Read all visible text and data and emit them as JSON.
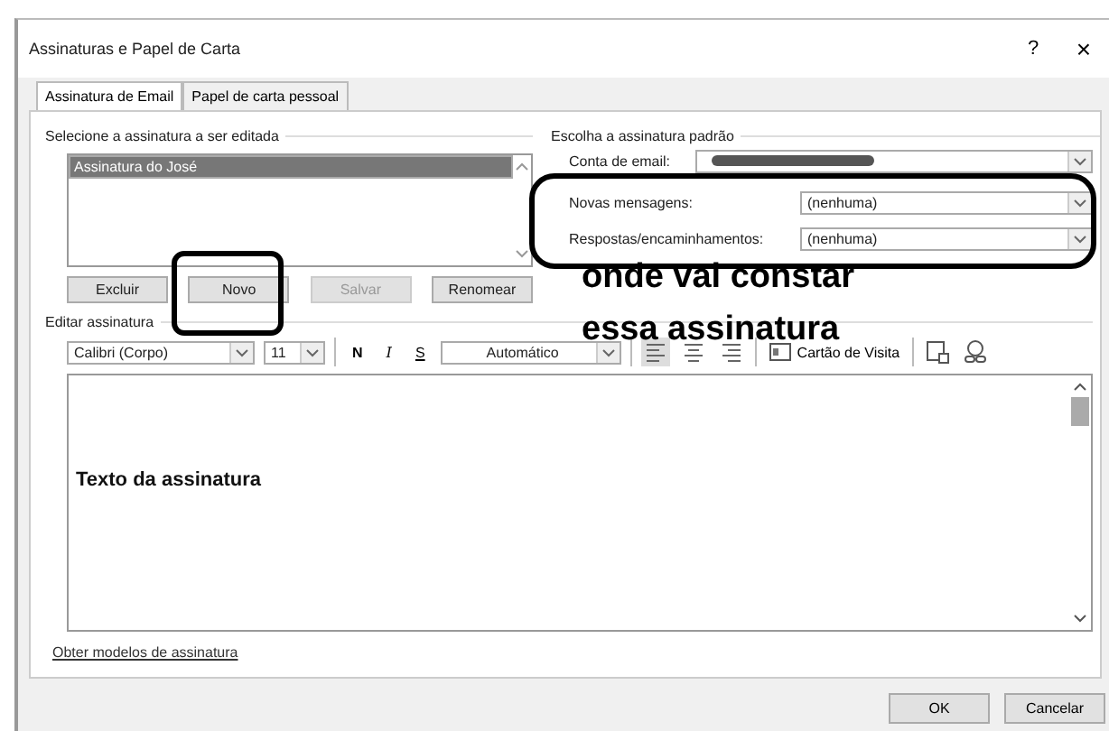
{
  "window": {
    "title": "Assinaturas e Papel de Carta",
    "help": "?",
    "close": "×"
  },
  "tabs": [
    {
      "label": "Assinatura de Email",
      "selected": true
    },
    {
      "label": "Papel de carta pessoal",
      "selected": false
    }
  ],
  "signatures": {
    "heading": "Selecione a assinatura a ser editada",
    "items": [
      {
        "label": "Assinatura do José",
        "selected": true
      }
    ],
    "buttons": [
      {
        "label": "Excluir",
        "disabled": false
      },
      {
        "label": "Novo",
        "disabled": false
      },
      {
        "label": "Salvar",
        "disabled": true
      },
      {
        "label": "Renomear",
        "disabled": false
      }
    ]
  },
  "defaults": {
    "heading": "Escolha a assinatura padrão",
    "fields": [
      {
        "kind": "account",
        "label": "Conta de email:"
      },
      {
        "kind": "select",
        "label": "Novas mensagens:",
        "value": "(nenhuma)"
      },
      {
        "kind": "select",
        "label": "Respostas/encaminhamentos:",
        "value": "(nenhuma)"
      }
    ]
  },
  "editor": {
    "heading": "Editar assinatura",
    "font": "Calibri (Corpo)",
    "size": "11",
    "bold": "N",
    "italic": "I",
    "strike": "S",
    "text_color_label": "Automático",
    "business_card": "Cartão de Visita",
    "body": "Texto da assinatura"
  },
  "link": "Obter modelos de assinatura",
  "buttons": [
    "OK",
    "Cancelar"
  ],
  "annotations": [
    "onde vai constar",
    "essa assinatura"
  ]
}
